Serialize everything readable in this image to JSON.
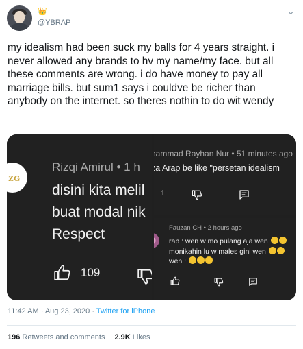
{
  "user": {
    "crown_icon": "crown-emoji",
    "handle": "@YBRAP"
  },
  "tweet": {
    "text": "my idealism had been suck my balls for 4 years straight. i never allowed any brands to hv my name/my face. but all these comments are wrong. i do have money to pay all marriage bills. but sum1 says i couldve be richer than anybody on the internet. so theres nothin to do wit wendy"
  },
  "media": {
    "left": {
      "logo_text": "ZG",
      "name_line": "Rizqi Amirul • 1 h",
      "lines": [
        "disini kita melil",
        "buat modal nik",
        "Respect"
      ],
      "like_count": "109"
    },
    "right_top": {
      "name_line": "hammad Rayhan Nur • 51 minutes ago",
      "text": "za Arap be like \"persetan idealism",
      "like_count": "1"
    },
    "right_bottom": {
      "name_line": "Fauzan CH • 2 hours ago",
      "line1": "rap : wen w mo pulang aja wen",
      "line2": "monikahin lu w males gini wen",
      "line3": "wen :"
    }
  },
  "meta": {
    "time": "11:42 AM · Aug 23, 2020 · ",
    "source": "Twitter for iPhone"
  },
  "stats": {
    "retweets_count": "196",
    "retweets_label": "Retweets and comments",
    "likes_count": "2.9K",
    "likes_label": "Likes"
  },
  "colors": {
    "link": "#1da1f2",
    "muted": "#657786",
    "dark_panel": "#212121"
  }
}
